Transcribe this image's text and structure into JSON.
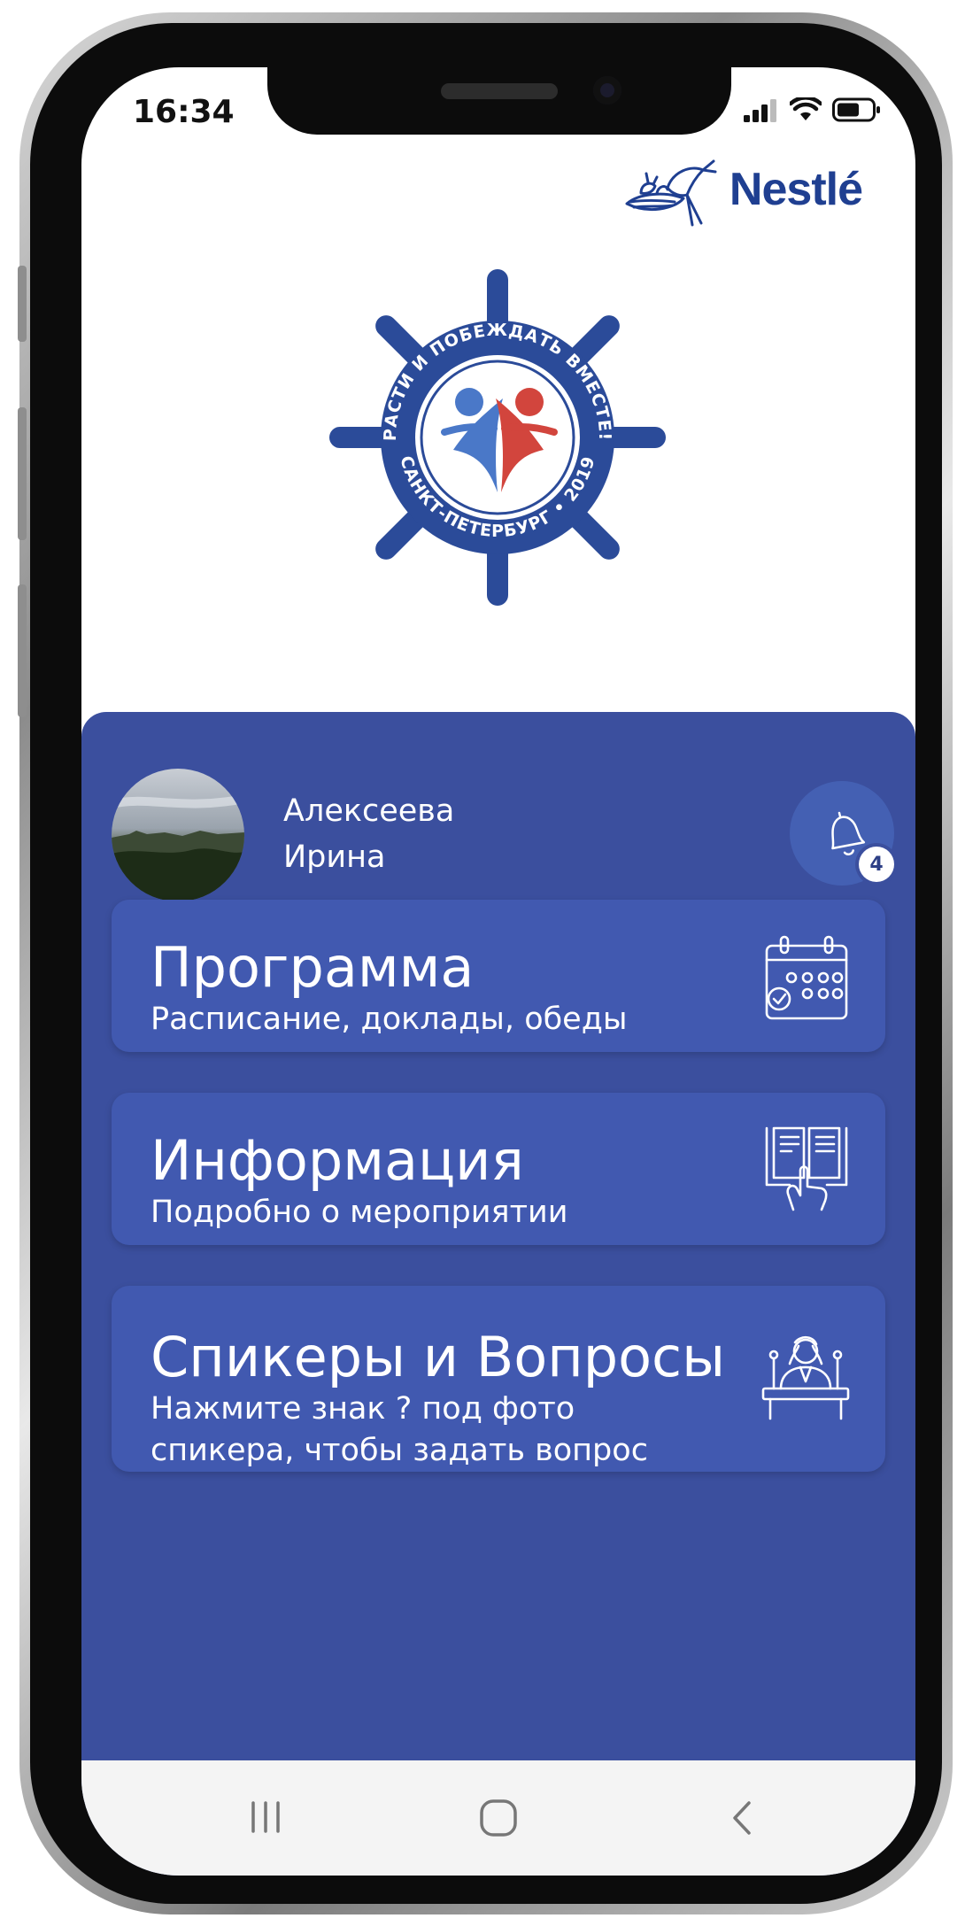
{
  "status_bar": {
    "time": "16:34"
  },
  "brand": {
    "name": "Nestlé"
  },
  "emblem": {
    "top_text": "РАСТИ И ПОБЕЖДАТЬ ВМЕСТЕ!",
    "bottom_text": "САНКТ-ПЕТЕРБУРГ • 2019"
  },
  "profile": {
    "last_name": "Алексеева",
    "first_name": "Ирина"
  },
  "notifications": {
    "count": "4"
  },
  "cards": [
    {
      "title": "Программа",
      "subtitle": "Расписание, доклады, обеды",
      "icon": "calendar-icon"
    },
    {
      "title": "Информация",
      "subtitle": "Подробно о мероприятии",
      "icon": "book-info-icon"
    },
    {
      "title": "Спикеры и Вопросы",
      "subtitle_line1": "Нажмите знак ? под фото",
      "subtitle_line2": "спикера, чтобы задать вопрос",
      "icon": "speaker-podium-icon"
    }
  ],
  "colors": {
    "panel": "#3b4f9e",
    "card": "#4159b0",
    "brand_blue": "#1f3f91",
    "emblem_red": "#d2453d",
    "emblem_blue": "#4a78c8"
  }
}
